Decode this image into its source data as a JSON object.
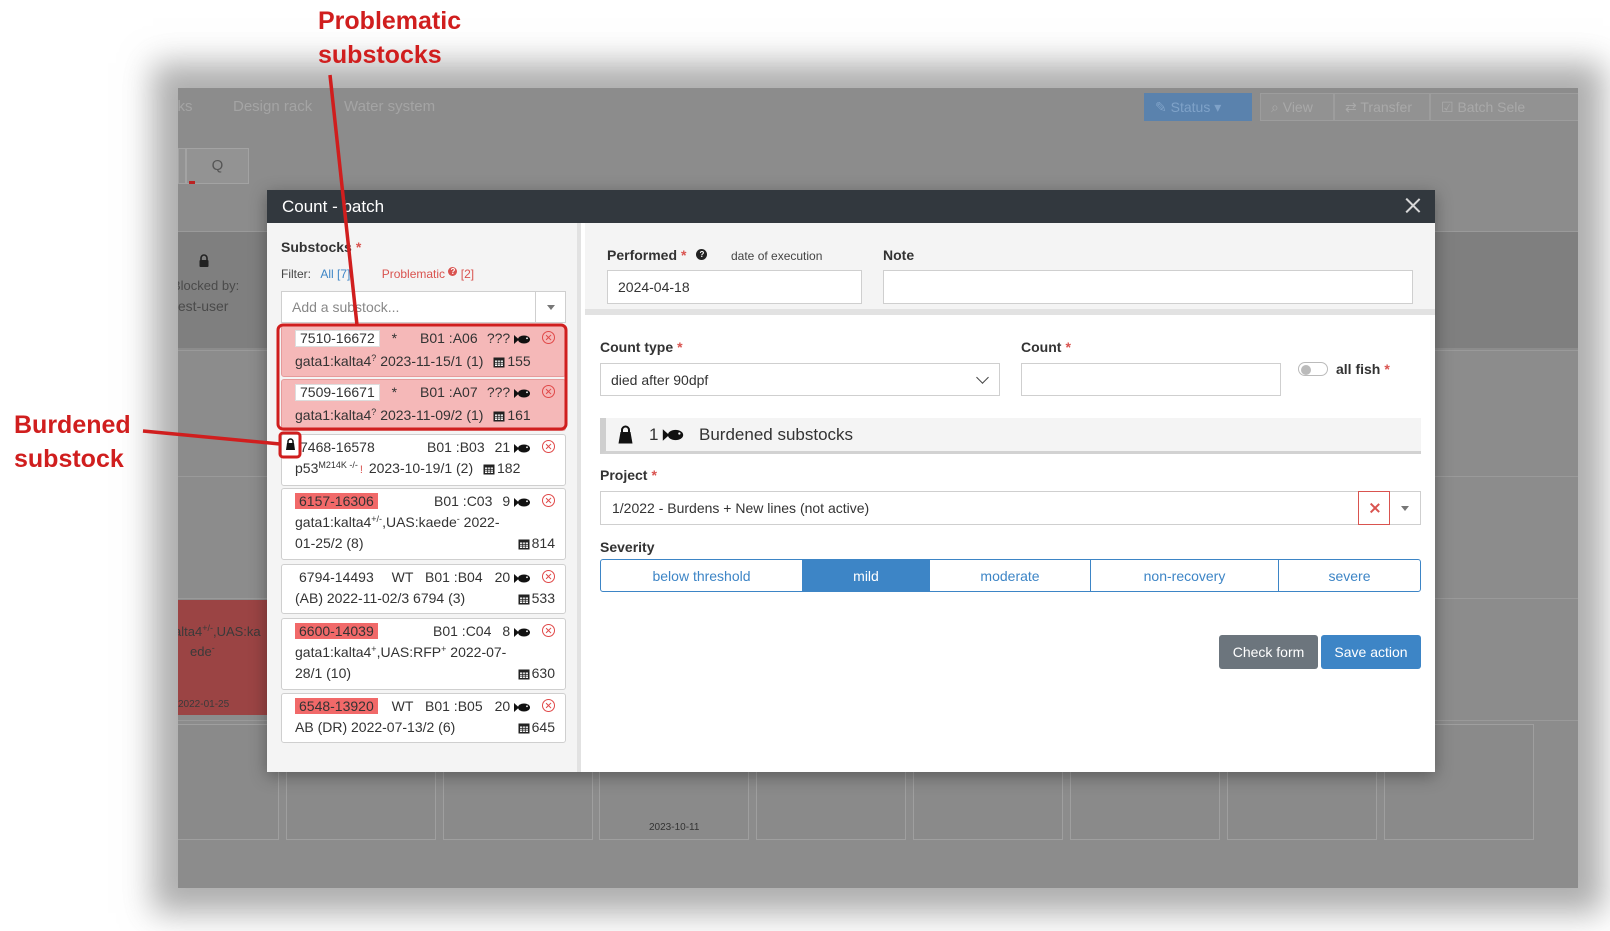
{
  "background": {
    "tabs": [
      "cks",
      "Design rack",
      "Water system"
    ],
    "buttons": {
      "status": "Status",
      "view": "View",
      "transfer": "Transfer",
      "batch_select": "Batch Sele"
    },
    "search_glyph": "Q",
    "blocked_by_label": "Blocked by:",
    "blocked_by_user": "test-user",
    "red_tile_line1": "alta4",
    "red_tile_sup": "+/-",
    "red_tile_line1b": ",UAS:ka",
    "red_tile_line2": "ede",
    "red_tile_line2_sup": "-",
    "red_tile_date": "2022-01-25",
    "cell_date": "2023-10-11"
  },
  "modal": {
    "title": "Count - batch",
    "substocks_label": "Substocks",
    "filter_label": "Filter:",
    "filter_all": "All [7]",
    "filter_problematic": "Problematic",
    "filter_problematic_count": "[2]",
    "problematic_badge": "?",
    "add_substock_placeholder": "Add a substock...",
    "substocks": [
      {
        "id": "7510-16672",
        "genotype_tag": "*",
        "position": "B01 :A06",
        "count": "???",
        "line2": "gata1:kalta4",
        "line2_sup": "?",
        "line2_rest": "2023-11-15/1 (1)",
        "tank": "155"
      },
      {
        "id": "7509-16671",
        "genotype_tag": "*",
        "position": "B01 :A07",
        "count": "???",
        "line2": "gata1:kalta4",
        "line2_sup": "?",
        "line2_rest": "2023-11-09/2 (1)",
        "tank": "161"
      },
      {
        "id": "7468-16578",
        "genotype_tag": "",
        "position": "B01 :B03",
        "count": "21",
        "line2": "p53",
        "line2_sup": "M214K -/-",
        "line2_rest": "2023-10-19/1 (2)",
        "tank": "182"
      },
      {
        "id": "6157-16306",
        "genotype_tag": "",
        "position": "B01 :C03",
        "count": "9",
        "line2": "gata1:kalta4",
        "line2_sup": "+/-",
        "line2_rest": ",UAS:kaede",
        "line2_sup2": "-",
        "line2_tail": "2022-",
        "line3": "01-25/2 (8)",
        "tank": "814"
      },
      {
        "id": "6794-14493",
        "genotype_tag": "WT",
        "position": "B01 :B04",
        "count": "20",
        "line2": "(AB) 2022-11-02/3 6794 (3)",
        "tank": "533"
      },
      {
        "id": "6600-14039",
        "genotype_tag": "",
        "position": "B01 :C04",
        "count": "8",
        "line2": "gata1:kalta4",
        "line2_sup": "+",
        "line2_rest": ",UAS:RFP",
        "line2_sup2": "+",
        "line2_tail": "2022-07-",
        "line3": "28/1 (10)",
        "tank": "630"
      },
      {
        "id": "6548-13920",
        "genotype_tag": "WT",
        "position": "B01 :B05",
        "count": "20",
        "line2": "AB (DR) 2022-07-13/2 (6)",
        "tank": "645"
      }
    ],
    "performed_label": "Performed",
    "performed_hint": "date of execution",
    "performed_value": "2024-04-18",
    "help_glyph": "?",
    "note_label": "Note",
    "note_value": "",
    "count_type_label": "Count type",
    "count_type_value": "died after 90dpf",
    "count_label": "Count",
    "count_value": "",
    "all_fish_label": "all fish",
    "burdened_count": "1",
    "burdened_label": "Burdened substocks",
    "project_label": "Project",
    "project_value": "1/2022 - Burdens + New lines (not active)",
    "severity_label": "Severity",
    "severity_options": [
      "below threshold",
      "mild",
      "moderate",
      "non-recovery",
      "severe"
    ],
    "severity_selected": "mild",
    "check_form_label": "Check form",
    "save_action_label": "Save action",
    "required_mark": "*"
  },
  "annotations": {
    "problematic_line1": "Problematic",
    "problematic_line2": "substocks",
    "burdened_line1": "Burdened",
    "burdened_line2": "substock"
  },
  "colors": {
    "annotation_red": "#d01e1e",
    "primary_blue": "#3d85c6",
    "problem_pink": "#f5b8b8",
    "id_red": "#f16969",
    "header_dark": "#32383e",
    "secondary_gray": "#6c757d"
  }
}
